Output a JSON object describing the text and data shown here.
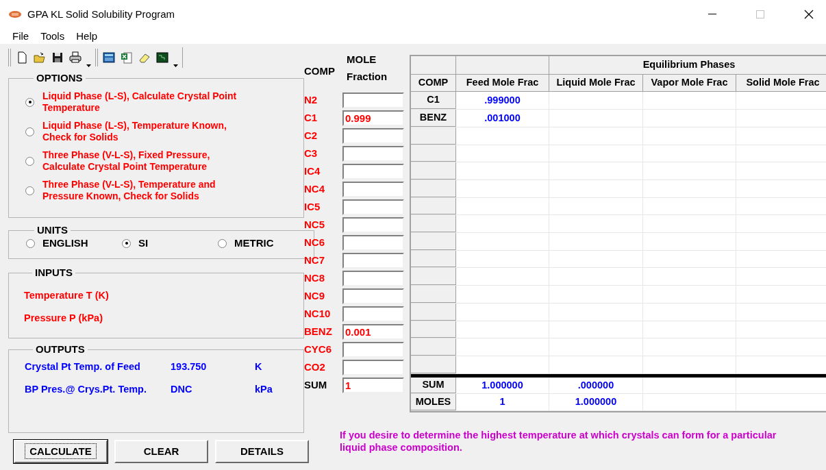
{
  "window": {
    "title": "GPA KL Solid Solubility Program"
  },
  "menu": [
    "File",
    "Tools",
    "Help"
  ],
  "options": {
    "title": "OPTIONS",
    "items": [
      {
        "label": "Liquid Phase (L-S), Calculate Crystal Point Temperature",
        "selected": true
      },
      {
        "label": "Liquid Phase (L-S), Temperature Known, Check for Solids",
        "selected": false
      },
      {
        "label": "Three Phase (V-L-S), Fixed Pressure, Calculate Crystal Point Temperature",
        "selected": false
      },
      {
        "label": "Three Phase (V-L-S), Temperature and Pressure Known, Check for Solids",
        "selected": false
      }
    ]
  },
  "units": {
    "title": "UNITS",
    "items": [
      {
        "label": "ENGLISH",
        "selected": false
      },
      {
        "label": "SI",
        "selected": true
      },
      {
        "label": "METRIC",
        "selected": false
      }
    ]
  },
  "inputs": {
    "title": "INPUTS",
    "items": [
      "Temperature T (K)",
      "Pressure P (kPa)"
    ]
  },
  "outputs": {
    "title": "OUTPUTS",
    "rows": [
      {
        "label": "Crystal Pt Temp. of Feed",
        "value": "193.750",
        "unit": "K"
      },
      {
        "label": "BP Pres.@ Crys.Pt. Temp.",
        "value": "DNC",
        "unit": "kPa"
      }
    ]
  },
  "buttons": [
    {
      "label": "CALCULATE",
      "focused": true
    },
    {
      "label": "CLEAR",
      "focused": false
    },
    {
      "label": "DETAILS",
      "focused": false
    }
  ],
  "composition": {
    "comp_header": "COMP",
    "fraction_header": [
      "MOLE",
      "Fraction"
    ],
    "rows": [
      {
        "comp": "N2"
      },
      {
        "comp": "C1",
        "value": "0.999"
      },
      {
        "comp": "C2"
      },
      {
        "comp": "C3"
      },
      {
        "comp": "IC4"
      },
      {
        "comp": "NC4"
      },
      {
        "comp": "IC5"
      },
      {
        "comp": "NC5"
      },
      {
        "comp": "NC6"
      },
      {
        "comp": "NC7"
      },
      {
        "comp": "NC8"
      },
      {
        "comp": "NC9"
      },
      {
        "comp": "NC10"
      },
      {
        "comp": "BENZ",
        "value": "0.001"
      },
      {
        "comp": "CYC6"
      },
      {
        "comp": "CO2"
      }
    ],
    "sum": {
      "label": "SUM",
      "value": "1"
    }
  },
  "grid": {
    "group_header": "Equilibrium Phases",
    "columns": [
      "COMP",
      "Feed Mole Frac",
      "Liquid Mole Frac",
      "Vapor Mole Frac",
      "Solid Mole Frac"
    ],
    "rows": [
      {
        "comp": "C1",
        "feed": ".999000"
      },
      {
        "comp": "BENZ",
        "feed": ".001000"
      }
    ],
    "totals": [
      {
        "label": "SUM",
        "feed": "1.000000",
        "liquid": ".000000"
      },
      {
        "label": "MOLES",
        "feed": "1",
        "liquid": "1.000000"
      }
    ]
  },
  "hint": "If you desire to determine the highest temperature at which crystals can form for a particular liquid phase composition."
}
